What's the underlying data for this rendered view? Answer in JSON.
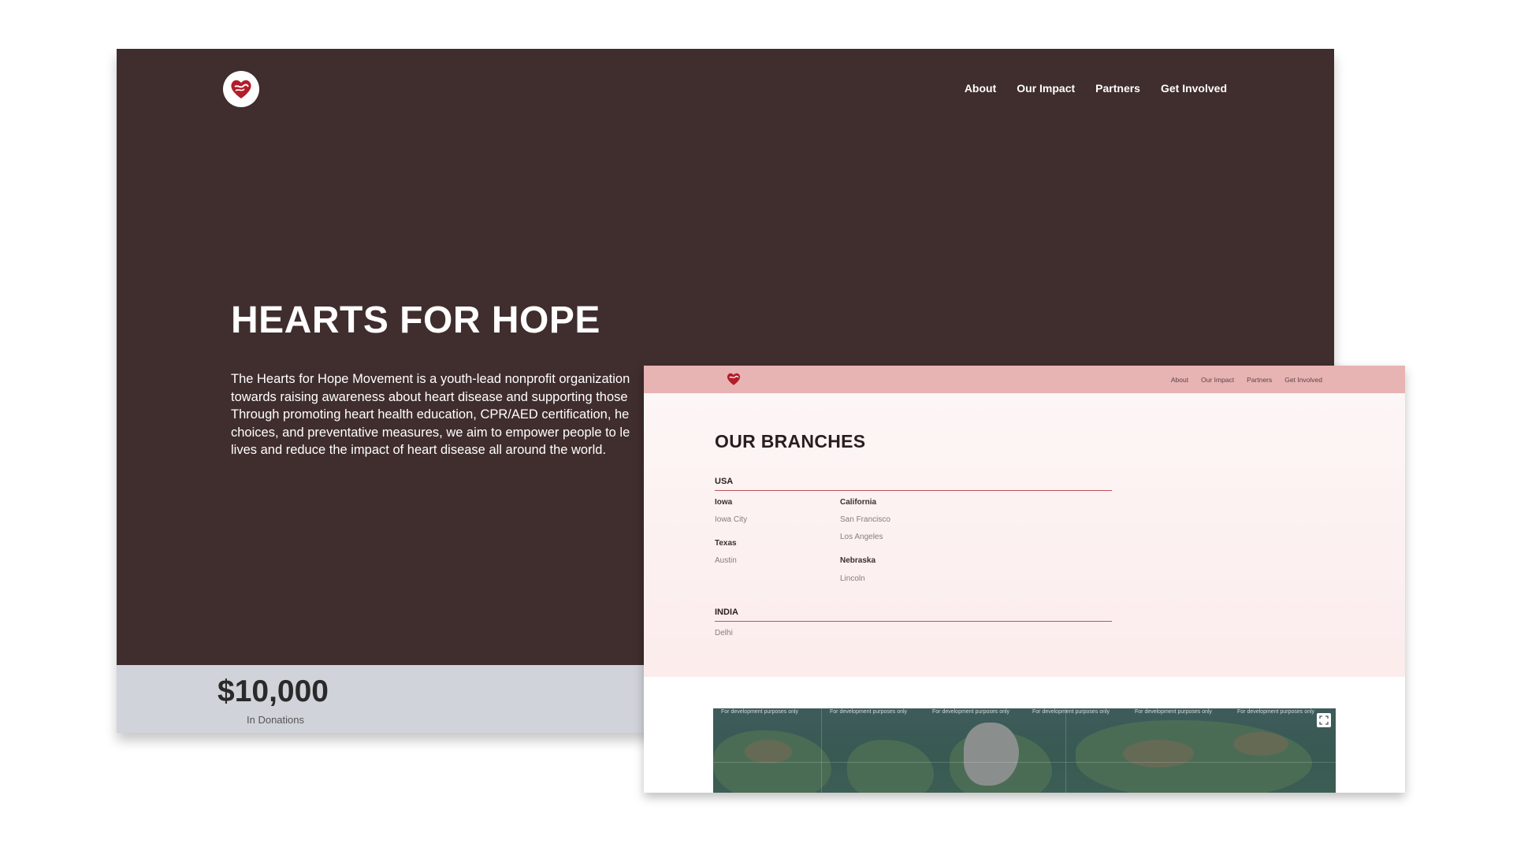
{
  "home": {
    "nav": [
      "About",
      "Our Impact",
      "Partners",
      "Get Involved"
    ],
    "hero_title": "HEARTS FOR HOPE",
    "hero_lines": [
      "The Hearts for Hope Movement is a youth-lead nonprofit organization",
      "towards raising awareness about heart disease and supporting those",
      "Through promoting heart health education, CPR/AED certification, he",
      "choices, and preventative measures, we aim to empower people to le",
      "lives and reduce the impact of heart disease all around the world."
    ],
    "stat_value": "$10,000",
    "stat_label": "In Donations"
  },
  "branches": {
    "nav": [
      "About",
      "Our Impact",
      "Partners",
      "Get Involved"
    ],
    "title": "OUR BRANCHES",
    "usa_label": "USA",
    "iowa": "Iowa",
    "iowa_city": "Iowa City",
    "texas": "Texas",
    "austin": "Austin",
    "california": "California",
    "san_francisco": "San Francisco",
    "los_angeles": "Los Angeles",
    "nebraska": "Nebraska",
    "lincoln": "Lincoln",
    "india_label": "INDIA",
    "delhi": "Delhi",
    "map_watermark": "For development purposes only"
  },
  "colors": {
    "hero_bg": "#402d2d",
    "stat_bg": "#d1d3da",
    "branches_nav_bg": "#e8b3b3",
    "branches_bg": "#fcecec",
    "accent": "#c0505a",
    "heart": "#b31d2a"
  },
  "icons": {
    "logo": "heart-logo-icon",
    "fullscreen": "fullscreen-icon"
  }
}
